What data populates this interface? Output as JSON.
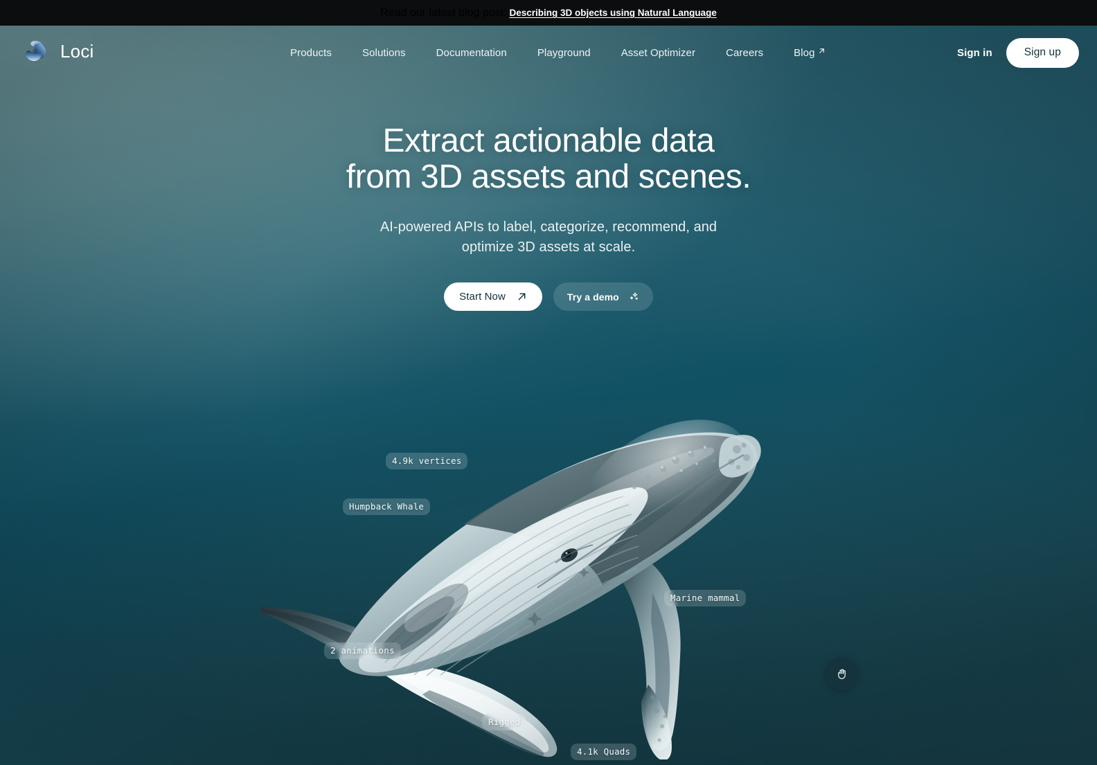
{
  "announcement": {
    "text": "Read our latest blog post:",
    "link_label": "Describing 3D objects using Natural Language"
  },
  "nav": {
    "brand": "Loci",
    "logo_icon": "loci-swirl-logo",
    "links": [
      {
        "label": "Products",
        "icon": ""
      },
      {
        "label": "Solutions",
        "icon": ""
      },
      {
        "label": "Documentation",
        "icon": ""
      },
      {
        "label": "Playground",
        "icon": ""
      },
      {
        "label": "Asset Optimizer",
        "icon": ""
      },
      {
        "label": "Careers",
        "icon": ""
      },
      {
        "label": "Blog",
        "icon": "external-link-arrow-icon"
      }
    ],
    "sign_in": "Sign in",
    "sign_up": "Sign up"
  },
  "hero": {
    "title_line1": "Extract actionable data",
    "title_line2": "from 3D assets and scenes.",
    "subtitle_line1": "AI-powered APIs to label, categorize, recommend, and",
    "subtitle_line2": "optimize 3D assets at scale.",
    "cta_primary": "Start Now",
    "cta_primary_icon": "arrow-up-right-icon",
    "cta_secondary": "Try a demo",
    "cta_secondary_icon": "sparkles-icon"
  },
  "viewer": {
    "model_name": "humpback-whale-3d-model",
    "grab_icon": "hand-grab-icon",
    "annotations": [
      {
        "id": "vertices",
        "label": "4.9k vertices"
      },
      {
        "id": "species",
        "label": "Humpback Whale"
      },
      {
        "id": "marine",
        "label": "Marine mammal"
      },
      {
        "id": "animations",
        "label": "2 animations"
      },
      {
        "id": "rigged",
        "label": "Rigged"
      },
      {
        "id": "quads",
        "label": "4.1k Quads"
      }
    ]
  },
  "colors": {
    "announcement_bg": "#0b0d0e",
    "hero_gradient_top_left": "#5c8086",
    "hero_gradient_mid_right": "#0e4558",
    "hero_gradient_bottom_left": "#1f5261",
    "hero_gradient_bottom_right": "#1c3b44",
    "cta_primary_bg": "#ffffff",
    "text_primary": "#ffffff",
    "grab_button_bg": "#15333c"
  }
}
